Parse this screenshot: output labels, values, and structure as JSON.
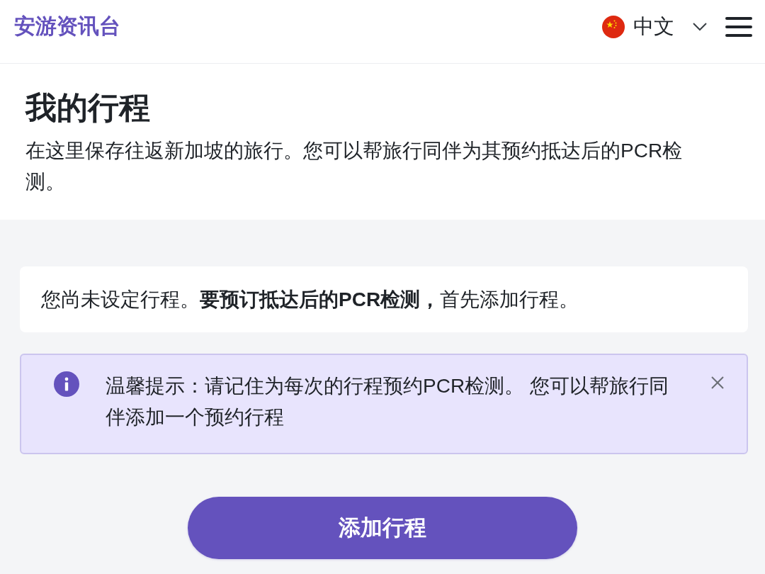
{
  "header": {
    "logo": "安游资讯台",
    "language": "中文"
  },
  "page": {
    "title": "我的行程",
    "description": "在这里保存往返新加坡的旅行。您可以帮旅行同伴为其预约抵达后的PCR检测。"
  },
  "notice": {
    "text": "您尚未设定行程。**要预订抵达后的PCR检测，**首先添加行程。"
  },
  "alert": {
    "text": "温馨提示：请记住为每次的行程预约PCR检测。 您可以帮旅行同伴添加一个预约行程"
  },
  "add_button": {
    "label": "添加行程"
  }
}
